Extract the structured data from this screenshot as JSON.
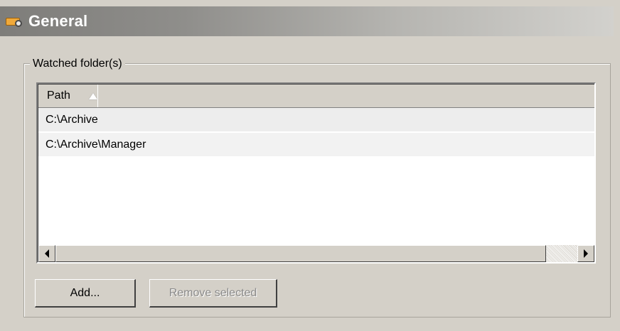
{
  "header": {
    "title": "General",
    "icon": "settings-gear-icon"
  },
  "watched_folders": {
    "legend": "Watched folder(s)",
    "columns": [
      {
        "label": "Path",
        "sort": "ascending"
      }
    ],
    "rows": [
      {
        "path": "C:\\Archive"
      },
      {
        "path": "C:\\Archive\\Manager"
      }
    ]
  },
  "buttons": {
    "add_label": "Add...",
    "remove_label": "Remove selected"
  }
}
